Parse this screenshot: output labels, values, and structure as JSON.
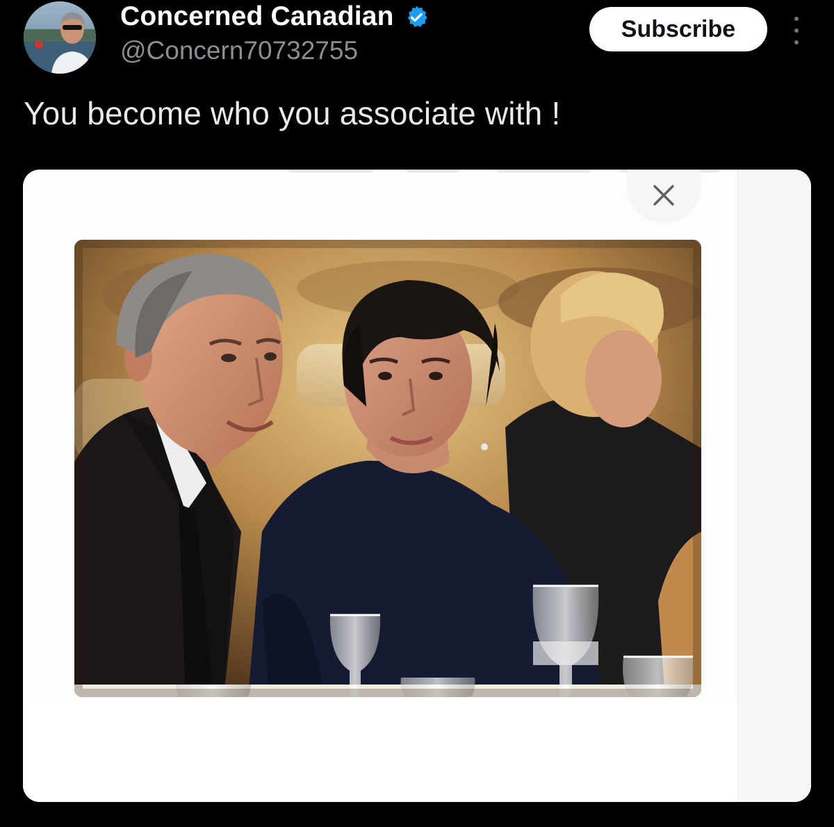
{
  "post": {
    "author": {
      "display_name": "Concerned Canadian",
      "handle": "@Concern70732755",
      "verified": true,
      "avatar_alt": "profile photo of a man wearing sunglasses"
    },
    "subscribe_label": "Subscribe",
    "text": "You become who you associate with !",
    "media": {
      "close_glyph": "✕",
      "photo_description": "photo of a man in a dark suit and a woman in a navy sweater seated at a dinner table with wine glasses"
    }
  },
  "colors": {
    "background": "#000000",
    "text_primary": "#e7e9ea",
    "text_secondary": "#8b8f94",
    "verified_blue": "#1d9bf0",
    "button_bg": "#ffffff",
    "button_text": "#0f1419"
  },
  "icons": {
    "verified": "verified-badge-icon",
    "more": "more-vertical-icon",
    "close": "close-icon"
  }
}
